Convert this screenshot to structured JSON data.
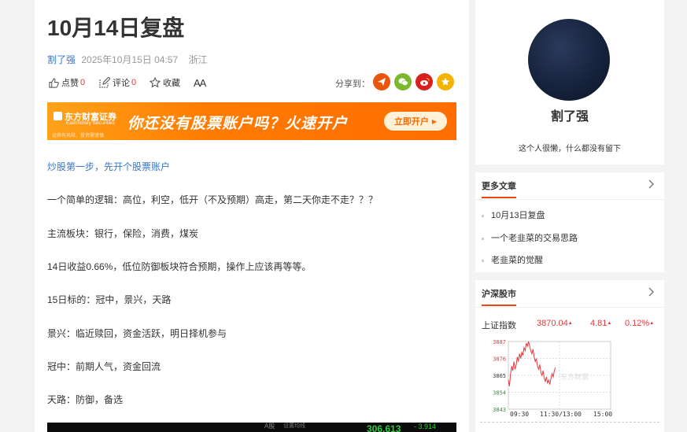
{
  "article": {
    "title": "10月14日复盘",
    "author": "割了强",
    "datetime": "2025年10月15日 04:57",
    "location": "浙江",
    "actions": {
      "like_label": "点赞",
      "like_count": "0",
      "comment_label": "评论",
      "comment_count": "0",
      "fav_label": "收藏",
      "font_label": "AA"
    },
    "share_label": "分享到：",
    "banner": {
      "logo": "东方财富证券",
      "logo_sub": "Eastmoney Securities",
      "small": "证券有风险，投资需谨慎",
      "main": "你还没有股票账户吗？火速开户",
      "button": "立即开户"
    },
    "open_account_link": "炒股第一步，先开个股票账户",
    "paragraphs": [
      "一个简单的逻辑：高位，利空，低开（不及预期）高走，第二天你走不走？？？",
      "主流板块：银行，保险，消费，煤炭",
      "14日收益0.66%，低位防御板块符合预期，操作上应该再等等。",
      "15日标的：冠中，景兴，天路",
      "景兴：临近赎回，资金活跃，明日择机参与",
      "冠中：前期人气，资金回流",
      "天路：防御，备选"
    ],
    "bottom_image": {
      "tab1": "A股",
      "tab2": "设置均线",
      "value": "306.613",
      "change": "- 3.914"
    }
  },
  "profile": {
    "name": "割了强",
    "bio": "这个人很懒，什么都没有留下"
  },
  "more_articles": {
    "title": "更多文章",
    "items": [
      "10月13日复盘",
      "一个老韭菜的交易思路",
      "老韭菜的觉醒"
    ]
  },
  "market": {
    "title": "沪深股市",
    "index_name": "上证指数",
    "price": "3870.04",
    "change": "4.81",
    "change_pct": "0.12%",
    "y_ticks": [
      "3887",
      "3876",
      "3865",
      "3854",
      "3843"
    ],
    "x_ticks": [
      "09:30",
      "11:30/13:00",
      "15:00"
    ],
    "watermark": "东方财富"
  },
  "chart_data": {
    "type": "line",
    "title": "",
    "series": [
      {
        "values": [
          3862,
          3858,
          3866,
          3871,
          3868,
          3874,
          3869,
          3872,
          3877,
          3874,
          3879,
          3876,
          3880,
          3878,
          3883,
          3881,
          3886,
          3884,
          3887,
          3884,
          3881,
          3879,
          3882,
          3877,
          3874,
          3876,
          3871,
          3869,
          3872,
          3867,
          3865,
          3868,
          3863,
          3861,
          3864,
          3860,
          3862,
          3859,
          3863,
          3866,
          3864,
          3868,
          3870
        ]
      }
    ],
    "ylim": [
      3843,
      3887
    ],
    "x_ticks": [
      "09:30",
      "11:30/13:00",
      "15:00"
    ],
    "grid": true
  },
  "colors": {
    "accent": "#e8450f",
    "link": "#3a77c4",
    "up": "#e4393c"
  }
}
